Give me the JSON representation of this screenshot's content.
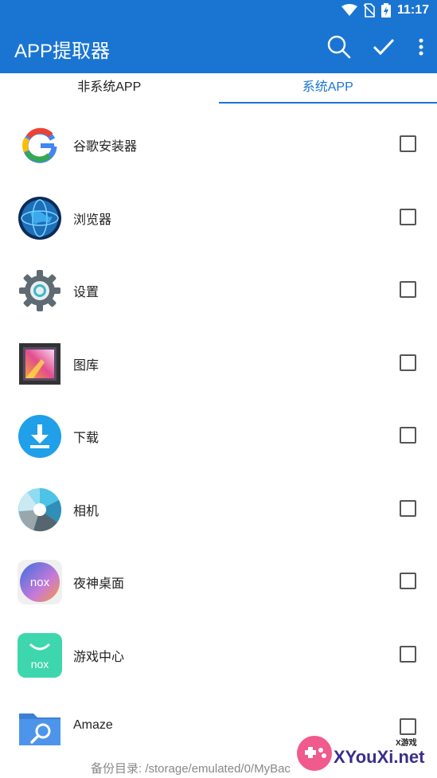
{
  "status": {
    "time": "11:17",
    "icons": [
      "wifi-icon",
      "no-sim-icon",
      "battery-charging-icon"
    ]
  },
  "appbar": {
    "title": "APP提取器",
    "icons": [
      "search-icon",
      "check-icon",
      "more-vert-icon"
    ]
  },
  "tabs": [
    {
      "label": "非系统APP",
      "active": false
    },
    {
      "label": "系统APP",
      "active": true
    }
  ],
  "apps": [
    {
      "name": "谷歌安装器",
      "icon": "google-icon",
      "checked": false
    },
    {
      "name": "浏览器",
      "icon": "globe-icon",
      "checked": false
    },
    {
      "name": "设置",
      "icon": "gear-icon",
      "checked": false
    },
    {
      "name": "图库",
      "icon": "gallery-icon",
      "checked": false
    },
    {
      "name": "下载",
      "icon": "download-icon",
      "checked": false
    },
    {
      "name": "相机",
      "icon": "camera-aperture-icon",
      "checked": false
    },
    {
      "name": "夜神桌面",
      "icon": "nox-launcher-icon",
      "checked": false
    },
    {
      "name": "游戏中心",
      "icon": "nox-game-center-icon",
      "checked": false
    },
    {
      "name": "Amaze",
      "icon": "amaze-folder-icon",
      "checked": false
    }
  ],
  "footer": {
    "backup_dir": "备份目录: /storage/emulated/0/MyBac"
  },
  "watermark": {
    "text": "XYouXi.net",
    "small": "X游戏"
  },
  "colors": {
    "primary": "#1a75d2",
    "text": "#222222",
    "muted": "#888888"
  }
}
